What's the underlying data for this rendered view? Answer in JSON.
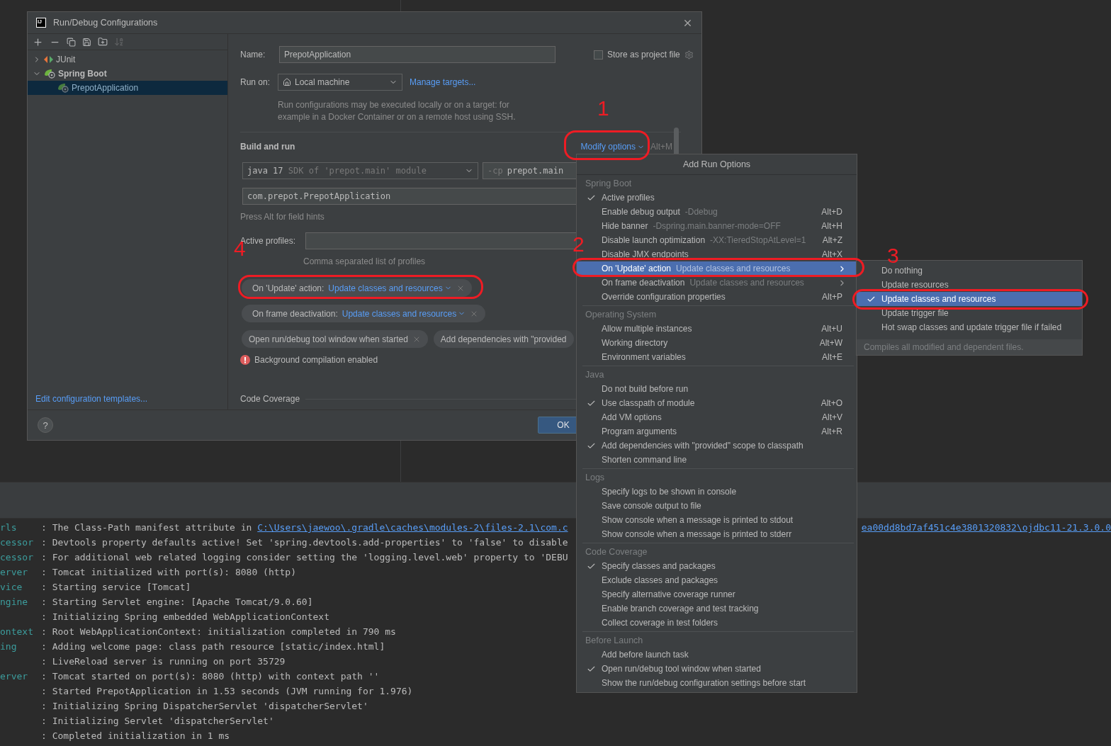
{
  "dialog": {
    "logo": "IJ",
    "title": "Run/Debug Configurations",
    "tree": [
      {
        "label": "JUnit",
        "kind": "junit",
        "expanded": false,
        "selected": false
      },
      {
        "label": "Spring Boot",
        "kind": "spring",
        "expanded": true,
        "selected": false,
        "children": [
          {
            "label": "PrepotApplication",
            "kind": "spring",
            "selected": true
          }
        ]
      }
    ],
    "templates_link": "Edit configuration templates...",
    "name_label": "Name:",
    "name_value": "PrepotApplication",
    "store_label": "Store as project file",
    "store_checked": false,
    "run_on_label": "Run on:",
    "run_on_value": "Local machine",
    "manage_targets": "Manage targets...",
    "run_on_hint": "Run configurations may be executed locally or on a target: for example in a Docker Container or on a remote host using SSH.",
    "section_title": "Build and run",
    "modify_options": "Modify options",
    "modify_shortcut": "Alt+M",
    "jdk_value": "java 17",
    "jdk_hint": "SDK of 'prepot.main' module",
    "cp_prefix": "-cp",
    "cp_value": "prepot.main",
    "main_class": "com.prepot.PrepotApplication",
    "field_hints": "Press Alt for field hints",
    "profiles_label": "Active profiles:",
    "profiles_hint": "Comma separated list of profiles",
    "chips": [
      {
        "kind": "option",
        "label": "On 'Update' action:",
        "value": "Update classes and resources",
        "removable": true
      },
      {
        "kind": "option",
        "label": "On frame deactivation:",
        "value": "Update classes and resources",
        "removable": true
      },
      {
        "kind": "flag",
        "label": "Open run/debug tool window when started",
        "removable": true
      },
      {
        "kind": "flag",
        "label": "Add dependencies with \"provided",
        "removable": false
      }
    ],
    "warning": "Background compilation enabled",
    "coverage_title": "Code Coverage",
    "help": "?",
    "ok": "OK"
  },
  "menu": {
    "title": "Add Run Options",
    "groups": [
      {
        "title": "Spring Boot",
        "items": [
          {
            "label": "Active profiles",
            "checked": true,
            "selected": false
          },
          {
            "label": "Enable debug output",
            "hint": "-Ddebug",
            "shortcut": "Alt+D",
            "checked": false,
            "selected": false
          },
          {
            "label": "Hide banner",
            "hint": "-Dspring.main.banner-mode=OFF",
            "shortcut": "Alt+H",
            "checked": false,
            "selected": false
          },
          {
            "label": "Disable launch optimization",
            "hint": "-XX:TieredStopAtLevel=1",
            "shortcut": "Alt+Z",
            "checked": false,
            "selected": false
          },
          {
            "label": "Disable JMX endpoints",
            "shortcut": "Alt+X",
            "checked": false,
            "selected": false
          },
          {
            "label": "On 'Update' action",
            "hint": "Update classes and resources",
            "submenu": true,
            "checked": false,
            "selected": true
          },
          {
            "label": "On frame deactivation",
            "hint": "Update classes and resources",
            "submenu": true,
            "checked": false,
            "selected": false
          },
          {
            "label": "Override configuration properties",
            "shortcut": "Alt+P",
            "checked": false,
            "selected": false
          }
        ]
      },
      {
        "title": "Operating System",
        "items": [
          {
            "label": "Allow multiple instances",
            "shortcut": "Alt+U",
            "checked": false,
            "selected": false
          },
          {
            "label": "Working directory",
            "shortcut": "Alt+W",
            "checked": false,
            "selected": false
          },
          {
            "label": "Environment variables",
            "shortcut": "Alt+E",
            "checked": false,
            "selected": false
          }
        ]
      },
      {
        "title": "Java",
        "items": [
          {
            "label": "Do not build before run",
            "checked": false,
            "selected": false
          },
          {
            "label": "Use classpath of module",
            "shortcut": "Alt+O",
            "checked": true,
            "selected": false
          },
          {
            "label": "Add VM options",
            "shortcut": "Alt+V",
            "checked": false,
            "selected": false
          },
          {
            "label": "Program arguments",
            "shortcut": "Alt+R",
            "checked": false,
            "selected": false
          },
          {
            "label": "Add dependencies with \"provided\" scope to classpath",
            "checked": true,
            "selected": false
          },
          {
            "label": "Shorten command line",
            "checked": false,
            "selected": false
          }
        ]
      },
      {
        "title": "Logs",
        "items": [
          {
            "label": "Specify logs to be shown in console",
            "checked": false,
            "selected": false
          },
          {
            "label": "Save console output to file",
            "checked": false,
            "selected": false
          },
          {
            "label": "Show console when a message is printed to stdout",
            "checked": false,
            "selected": false
          },
          {
            "label": "Show console when a message is printed to stderr",
            "checked": false,
            "selected": false
          }
        ]
      },
      {
        "title": "Code Coverage",
        "items": [
          {
            "label": "Specify classes and packages",
            "checked": true,
            "selected": false
          },
          {
            "label": "Exclude classes and packages",
            "checked": false,
            "selected": false
          },
          {
            "label": "Specify alternative coverage runner",
            "checked": false,
            "selected": false
          },
          {
            "label": "Enable branch coverage and test tracking",
            "checked": false,
            "selected": false
          },
          {
            "label": "Collect coverage in test folders",
            "checked": false,
            "selected": false
          }
        ]
      },
      {
        "title": "Before Launch",
        "items": [
          {
            "label": "Add before launch task",
            "checked": false,
            "selected": false
          },
          {
            "label": "Open run/debug tool window when started",
            "checked": true,
            "selected": false
          },
          {
            "label": "Show the run/debug configuration settings before start",
            "checked": false,
            "selected": false
          }
        ]
      }
    ]
  },
  "submenu": {
    "items": [
      {
        "label": "Do nothing",
        "checked": false,
        "selected": false
      },
      {
        "label": "Update resources",
        "checked": false,
        "selected": false
      },
      {
        "label": "Update classes and resources",
        "checked": true,
        "selected": true
      },
      {
        "label": "Update trigger file",
        "checked": false,
        "selected": false
      },
      {
        "label": "Hot swap classes and update trigger file if failed",
        "checked": false,
        "selected": false
      }
    ],
    "footer": "Compiles all modified and dependent files."
  },
  "console": {
    "lines": [
      {
        "source": "rls",
        "text": ": The Class-Path manifest attribute in ",
        "link": "C:\\Users\\jaewoo\\.gradle\\caches\\modules-2\\files-2.1\\com.c",
        "link_tail": "ea00dd8bd7af451c4e3801320832\\ojdbc11-21.3.0.0"
      },
      {
        "source": "cessor",
        "text": ": Devtools property defaults active! Set 'spring.devtools.add-properties' to 'false' to disable"
      },
      {
        "source": "cessor",
        "text": ": For additional web related logging consider setting the 'logging.level.web' property to 'DEBU"
      },
      {
        "source": "erver",
        "text": ": Tomcat initialized with port(s): 8080 (http)"
      },
      {
        "source": "vice",
        "text": ": Starting service [Tomcat]"
      },
      {
        "source": "ngine",
        "text": ": Starting Servlet engine: [Apache Tomcat/9.0.60]"
      },
      {
        "text": ": Initializing Spring embedded WebApplicationContext"
      },
      {
        "source": "ontext",
        "text": ": Root WebApplicationContext: initialization completed in 790 ms"
      },
      {
        "source": "ing",
        "text": ": Adding welcome page: class path resource [static/index.html]"
      },
      {
        "text": ": LiveReload server is running on port 35729"
      },
      {
        "source": "erver",
        "text": ": Tomcat started on port(s): 8080 (http) with context path ''"
      },
      {
        "text": ": Started PrepotApplication in 1.53 seconds (JVM running for 1.976)"
      },
      {
        "text": ": Initializing Spring DispatcherServlet 'dispatcherServlet'"
      },
      {
        "text": ": Initializing Servlet 'dispatcherServlet'"
      },
      {
        "text": ": Completed initialization in 1 ms"
      }
    ]
  },
  "annotations": [
    "1",
    "2",
    "3",
    "4"
  ]
}
